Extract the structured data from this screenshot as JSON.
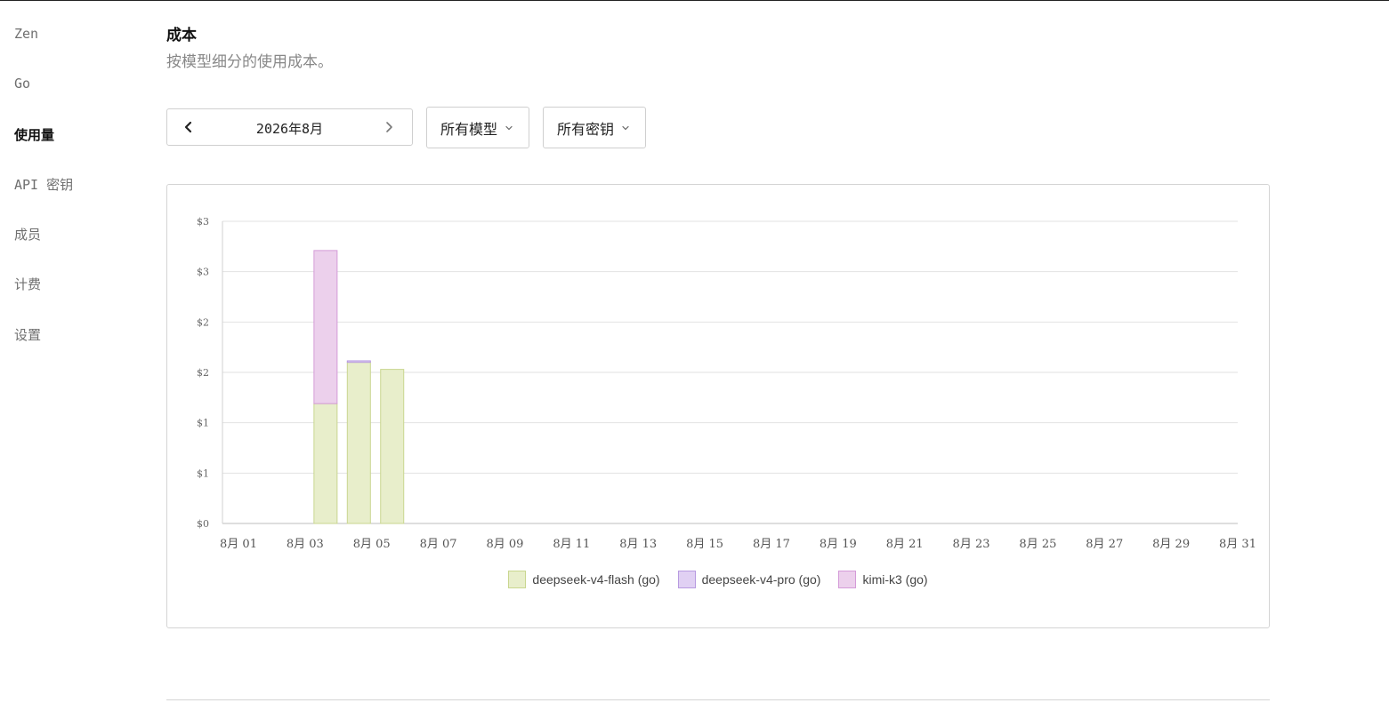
{
  "sidebar": {
    "items": [
      {
        "label": "Zen",
        "active": false
      },
      {
        "label": "Go",
        "active": false
      },
      {
        "label": "使用量",
        "active": true
      },
      {
        "label": "API 密钥",
        "active": false
      },
      {
        "label": "成员",
        "active": false
      },
      {
        "label": "计费",
        "active": false
      },
      {
        "label": "设置",
        "active": false
      }
    ]
  },
  "section": {
    "title": "成本",
    "subtitle": "按模型细分的使用成本。"
  },
  "controls": {
    "month": "2026年8月",
    "model_filter": "所有模型",
    "key_filter": "所有密钥",
    "prev_icon": "chevron-left-icon",
    "next_icon": "chevron-right-icon",
    "dropdown_icon": "chevron-down-icon"
  },
  "chart_data": {
    "type": "bar",
    "stacked": true,
    "ylim": [
      0,
      3
    ],
    "y_ticks": [
      0,
      0.5,
      1,
      1.5,
      2,
      2.5,
      3
    ],
    "y_tick_labels": [
      "$0",
      "$1",
      "$1",
      "$2",
      "$2",
      "$3",
      "$3"
    ],
    "categories": [
      "8月 01",
      "8月 02",
      "8月 03",
      "8月 04",
      "8月 05",
      "8月 06",
      "8月 07",
      "8月 08",
      "8月 09",
      "8月 10",
      "8月 11",
      "8月 12",
      "8月 13",
      "8月 14",
      "8月 15",
      "8月 16",
      "8月 17",
      "8月 18",
      "8月 19",
      "8月 20",
      "8月 21",
      "8月 22",
      "8月 23",
      "8月 24",
      "8月 25",
      "8月 26",
      "8月 27",
      "8月 28",
      "8月 29",
      "8月 30",
      "8月 31"
    ],
    "x_tick_labels": [
      "8月 01",
      "8月 03",
      "8月 05",
      "8月 07",
      "8月 09",
      "8月 11",
      "8月 13",
      "8月 15",
      "8月 17",
      "8月 19",
      "8月 21",
      "8月 23",
      "8月 25",
      "8月 27",
      "8月 29",
      "8月 31"
    ],
    "series": [
      {
        "name": "deepseek-v4-flash (go)",
        "fill": "#e8eecb",
        "stroke": "#c9d68f",
        "values": [
          0,
          0,
          1.19,
          1.6,
          1.53,
          0,
          0,
          0,
          0,
          0,
          0,
          0,
          0,
          0,
          0,
          0,
          0,
          0,
          0,
          0,
          0,
          0,
          0,
          0,
          0,
          0,
          0,
          0,
          0,
          0,
          0
        ]
      },
      {
        "name": "deepseek-v4-pro (go)",
        "fill": "#e0d0f3",
        "stroke": "#b79ae0",
        "values": [
          0,
          0,
          0,
          0.015,
          0,
          0,
          0,
          0,
          0,
          0,
          0,
          0,
          0,
          0,
          0,
          0,
          0,
          0,
          0,
          0,
          0,
          0,
          0,
          0,
          0,
          0,
          0,
          0,
          0,
          0,
          0
        ]
      },
      {
        "name": "kimi-k3 (go)",
        "fill": "#ecd0ec",
        "stroke": "#d49bd8",
        "values": [
          0,
          0,
          1.52,
          0,
          0,
          0,
          0,
          0,
          0,
          0,
          0,
          0,
          0,
          0,
          0,
          0,
          0,
          0,
          0,
          0,
          0,
          0,
          0,
          0,
          0,
          0,
          0,
          0,
          0,
          0,
          0
        ]
      }
    ],
    "legend_position": "bottom",
    "grid": true
  }
}
